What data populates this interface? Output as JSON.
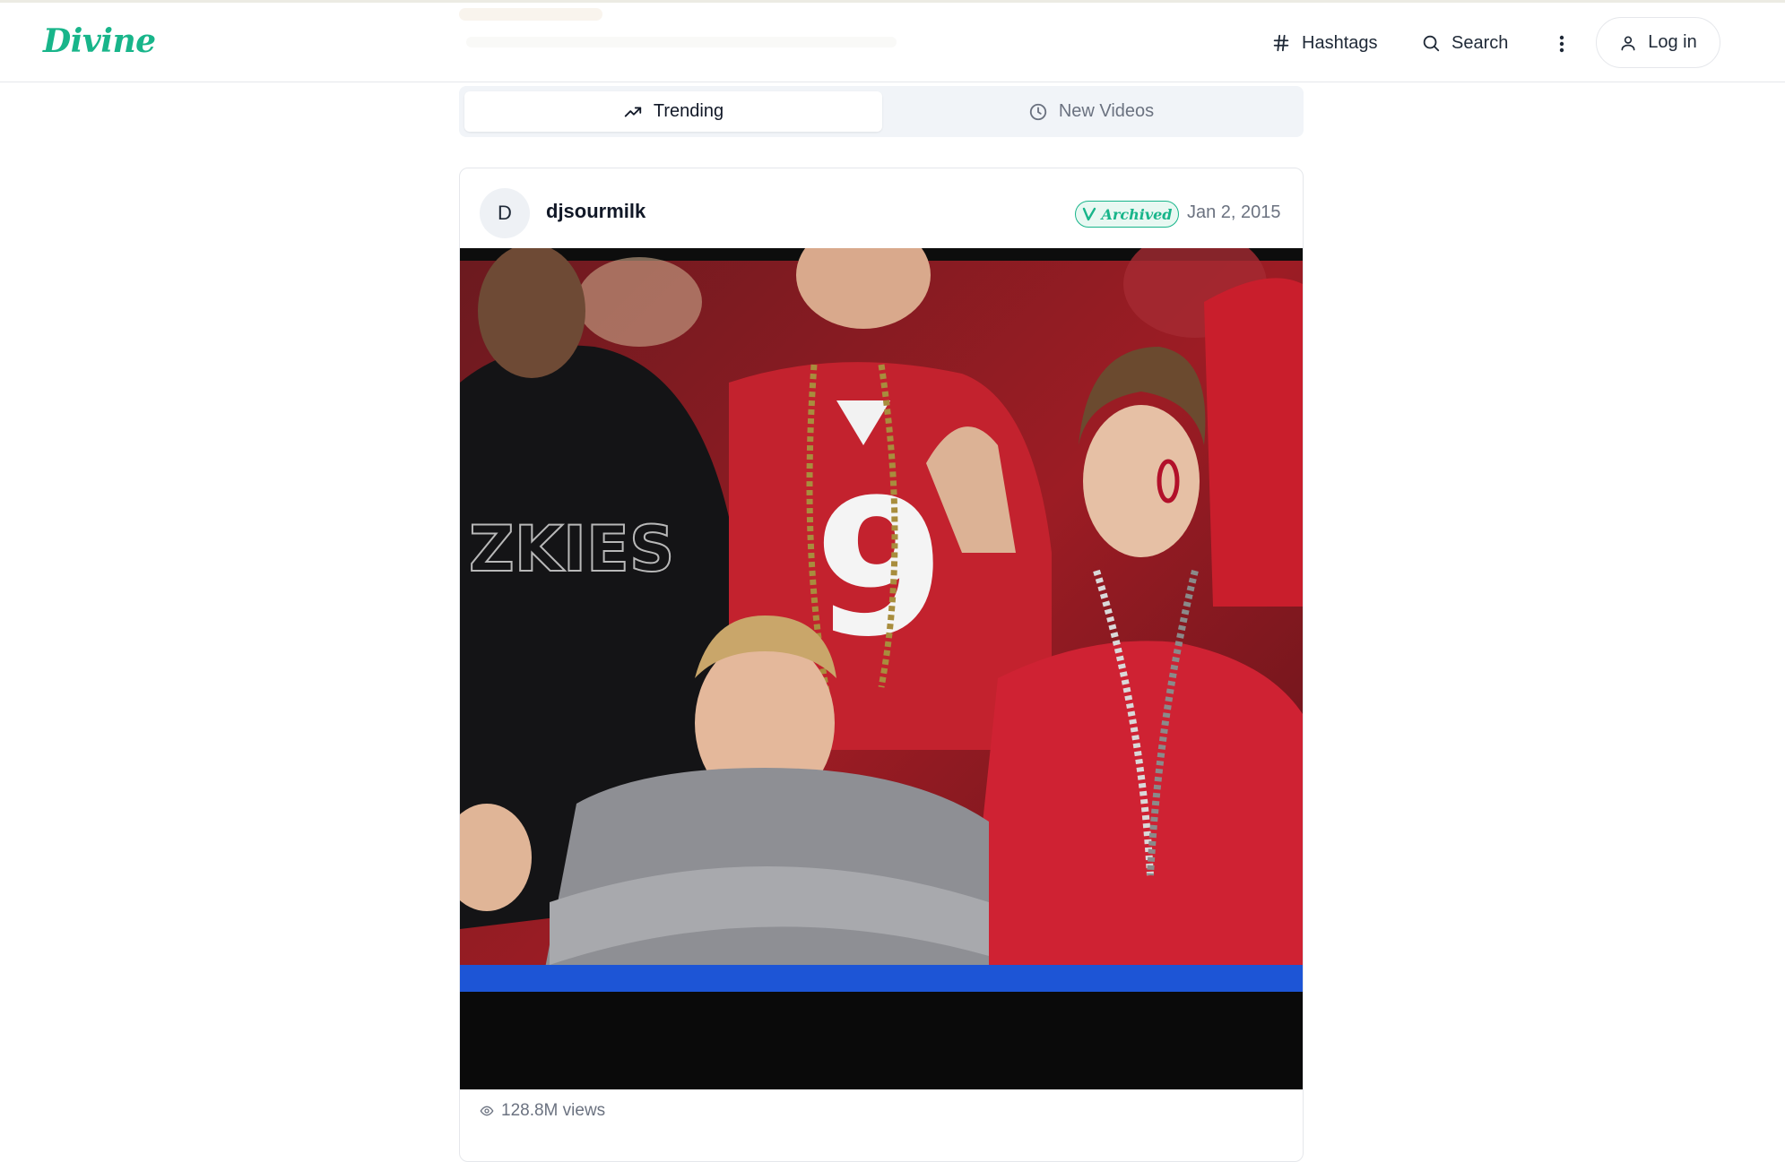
{
  "app": {
    "logo": "Divine"
  },
  "header": {
    "hashtags_label": "Hashtags",
    "search_label": "Search",
    "login_label": "Log in",
    "icons": {
      "hashtags": "hash-icon",
      "search": "search-icon",
      "more": "more-vertical-icon",
      "login": "user-icon"
    }
  },
  "tabs": [
    {
      "label": "Trending",
      "icon": "trending-up-icon",
      "active": true
    },
    {
      "label": "New Videos",
      "icon": "clock-icon",
      "active": false
    }
  ],
  "post": {
    "avatar_initial": "D",
    "username": "djsourmilk",
    "badge": "Archived",
    "date": "Jan 2, 2015",
    "views": "128.8M views"
  },
  "colors": {
    "brand": "#18b58a",
    "muted_text": "#6b7280",
    "tab_bg": "#f1f4f8",
    "border": "#e5e7eb"
  }
}
